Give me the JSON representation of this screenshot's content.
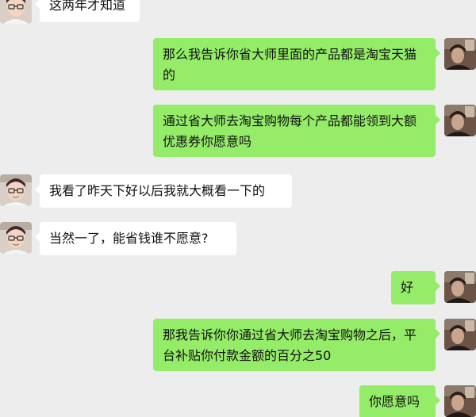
{
  "chat": {
    "messages": [
      {
        "side": "in",
        "text": "这两年才知道"
      },
      {
        "side": "out",
        "text": "那么我告诉你省大师里面的产品都是淘宝天猫的"
      },
      {
        "side": "out",
        "text": "通过省大师去淘宝购物每个产品都能领到大额优惠券你愿意吗"
      },
      {
        "side": "in",
        "text": "我看了昨天下好以后我就大概看一下的"
      },
      {
        "side": "in",
        "text": "当然一了，能省钱谁不愿意?"
      },
      {
        "side": "out",
        "text": "好"
      },
      {
        "side": "out",
        "text": "那我告诉你你通过省大师去淘宝购物之后，平台补贴你付款金额的百分之50"
      },
      {
        "side": "out",
        "text": "你愿意吗"
      }
    ]
  },
  "colors": {
    "background": "#ededed",
    "incoming_bubble": "#ffffff",
    "outgoing_bubble": "#95ec69",
    "text": "#111111"
  },
  "icons": {
    "incoming_avatar": "contact-avatar-icon",
    "outgoing_avatar": "user-avatar-icon"
  }
}
